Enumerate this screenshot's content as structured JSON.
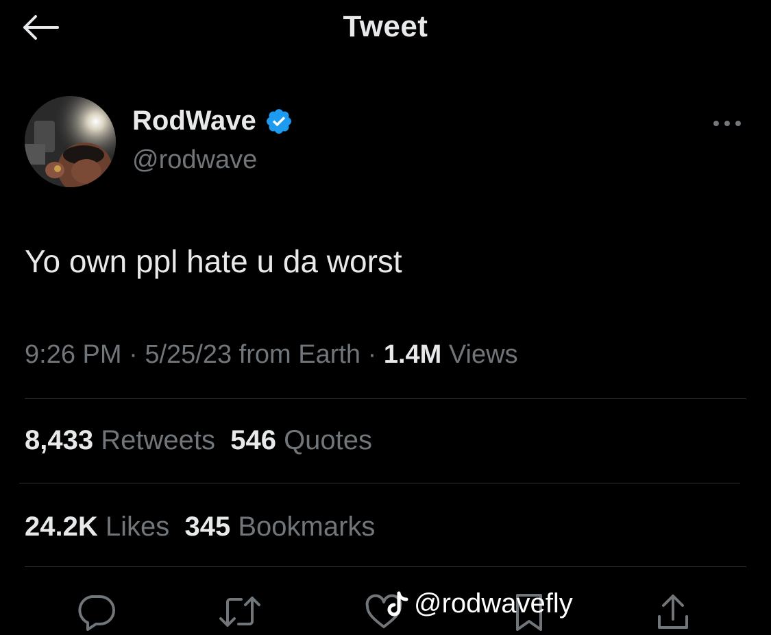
{
  "header": {
    "title": "Tweet",
    "back_icon": "arrow-left-icon"
  },
  "author": {
    "display_name": "RodWave",
    "handle": "@rodwave",
    "verified": true,
    "verified_color": "#1d9bf0"
  },
  "tweet": {
    "text": "Yo own ppl hate u da worst"
  },
  "meta": {
    "time": "9:26 PM",
    "sep1": " · ",
    "date": "5/25/23",
    "source": " from Earth",
    "sep2": " · ",
    "views_count": "1.4M",
    "views_label": " Views"
  },
  "stats": {
    "retweets_count": "8,433",
    "retweets_label": " Retweets",
    "quotes_count": "546",
    "quotes_label": " Quotes",
    "likes_count": "24.2K",
    "likes_label": " Likes",
    "bookmarks_count": "345",
    "bookmarks_label": " Bookmarks"
  },
  "actions": [
    "reply-icon",
    "retweet-icon",
    "like-icon",
    "bookmark-icon",
    "share-icon"
  ],
  "watermark": {
    "text": "@rodwavefly",
    "icon": "tiktok-icon"
  },
  "colors": {
    "background": "#000000",
    "text_primary": "#e7e9ea",
    "text_secondary": "#71767b",
    "divider": "#2f3336",
    "accent": "#1d9bf0"
  }
}
